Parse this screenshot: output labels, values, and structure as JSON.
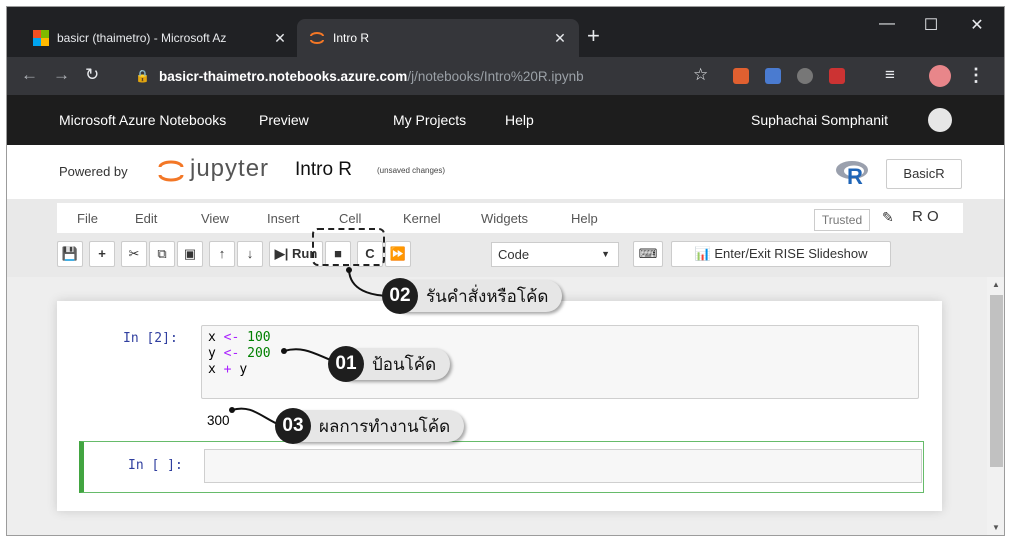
{
  "browser": {
    "tabs": [
      {
        "title": "basicr (thaimetro) - Microsoft Az"
      },
      {
        "title": "Intro R"
      }
    ],
    "url_host": "basicr-thaimetro.notebooks.azure.com",
    "url_path": "/j/notebooks/Intro%20R.ipynb"
  },
  "azure": {
    "product": "Microsoft Azure Notebooks",
    "preview": "Preview",
    "my_projects": "My Projects",
    "help": "Help",
    "user": "Suphachai Somphanit"
  },
  "jupyter": {
    "powered_by": "Powered by",
    "wordmark": "jupyter",
    "notebook_name": "Intro R",
    "unsaved": "(unsaved changes)",
    "kernel": "BasicR",
    "menu": [
      "File",
      "Edit",
      "View",
      "Insert",
      "Cell",
      "Kernel",
      "Widgets",
      "Help"
    ],
    "trusted": "Trusted",
    "kernel_letter": "R",
    "run_label": "Run",
    "cell_type": "Code",
    "rise_label": "Enter/Exit RISE Slideshow"
  },
  "cells": {
    "cell1_prompt": "In [2]:",
    "cell1_lines": [
      {
        "a": "x",
        "op": "<-",
        "b": "100"
      },
      {
        "a": "y",
        "op": "<-",
        "b": "200"
      },
      {
        "a": "x",
        "op": "+",
        "b": "y"
      }
    ],
    "cell1_output": "300",
    "cell2_prompt": "In [ ]:"
  },
  "callouts": [
    {
      "num": "02",
      "text": "รันคำสั่งหรือโค้ด"
    },
    {
      "num": "01",
      "text": "ป้อนโค้ด"
    },
    {
      "num": "03",
      "text": "ผลการทำงานโค้ด"
    }
  ]
}
